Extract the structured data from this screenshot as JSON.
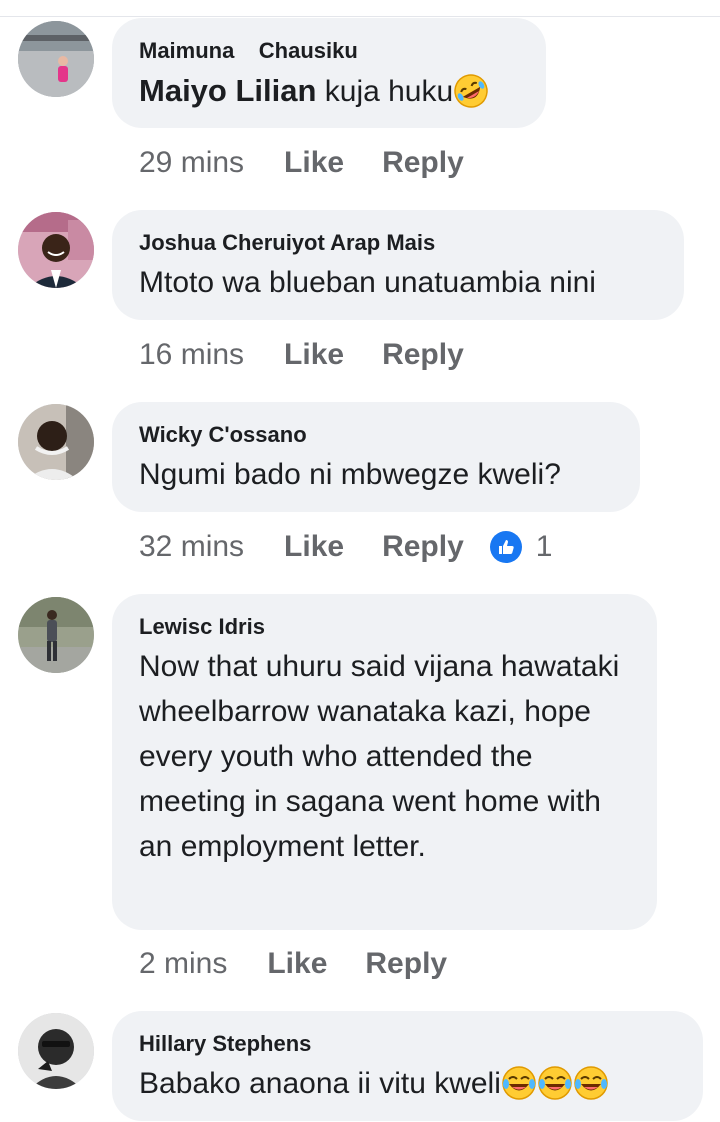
{
  "colors": {
    "bubble": "#f0f2f5",
    "text": "#1c1e21",
    "meta": "#65676b",
    "like_blue": "#1877f2"
  },
  "comments": [
    {
      "author": "Maimuna    Chausiku",
      "mention": "Maiyo Lilian",
      "text": " kuja huku",
      "emojis": [
        "rolling-on-floor-laughing-emoji"
      ],
      "time": "29 mins",
      "like_label": "Like",
      "reply_label": "Reply"
    },
    {
      "author": "Joshua Cheruiyot Arap Mais",
      "text": "Mtoto wa blueban unatuambia nini",
      "time": "16 mins",
      "like_label": "Like",
      "reply_label": "Reply"
    },
    {
      "author": "Wicky C'ossano",
      "text": "Ngumi bado ni mbwegze kweli?",
      "time": "32 mins",
      "like_label": "Like",
      "reply_label": "Reply",
      "reaction_icon": "thumbs-up-icon",
      "reaction_count": "1"
    },
    {
      "author": "Lewisc Idris",
      "text": "Now that uhuru said vijana hawataki wheelbarrow wanataka kazi, hope every youth who attended the meeting in sagana went home with an employment letter.",
      "time": "2 mins",
      "like_label": "Like",
      "reply_label": "Reply"
    },
    {
      "author": "Hillary Stephens",
      "text": "Babako anaona ii vitu kweli",
      "emojis": [
        "tears-of-joy-emoji",
        "tears-of-joy-emoji",
        "tears-of-joy-emoji"
      ]
    }
  ]
}
